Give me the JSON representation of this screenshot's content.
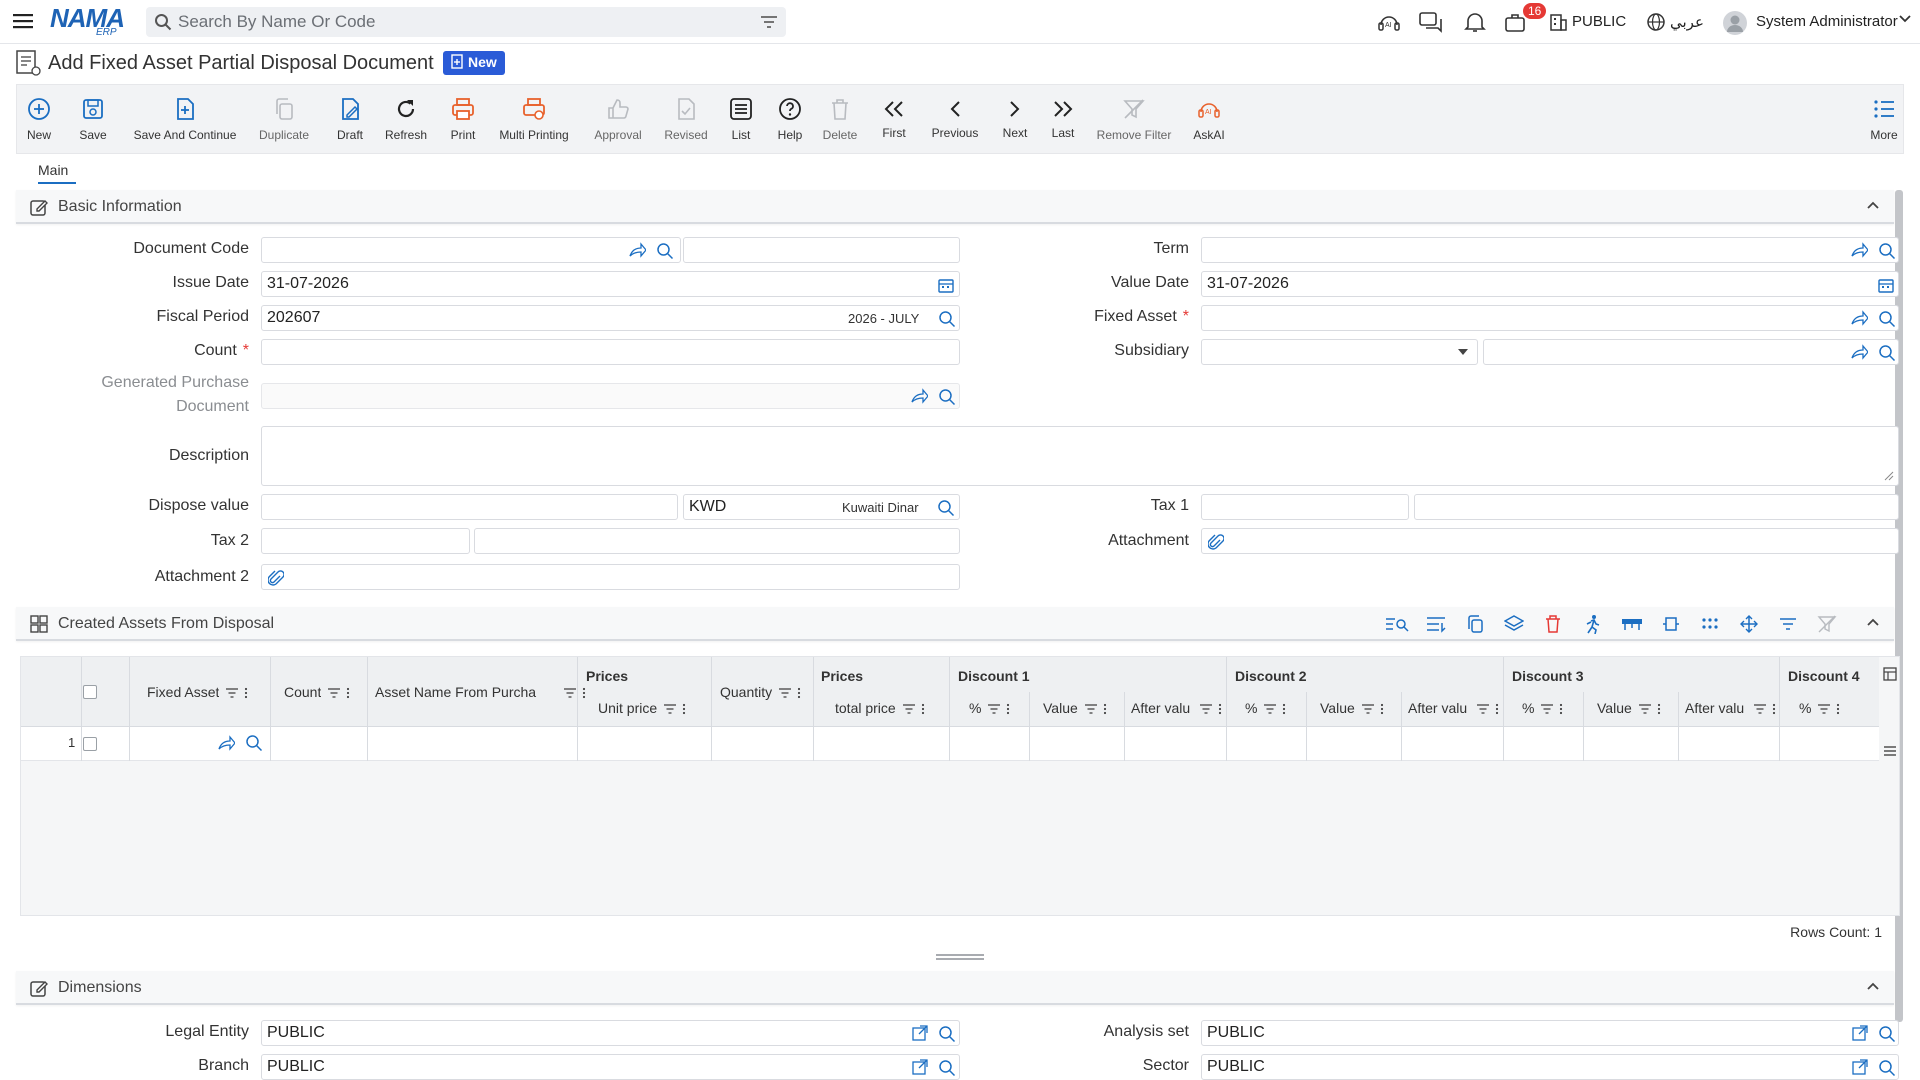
{
  "header": {
    "logo_main": "NAMA",
    "logo_sub": "ERP",
    "search_placeholder": "Search By Name Or Code",
    "notifications_count": "16",
    "company": "PUBLIC",
    "language": "عربي",
    "user": "System Administrator"
  },
  "page": {
    "title": "Add Fixed Asset Partial Disposal Document",
    "status_badge": "New"
  },
  "toolbar": [
    {
      "id": "new",
      "label": "New",
      "icon": "plus-circle-icon"
    },
    {
      "id": "save",
      "label": "Save",
      "icon": "save-icon"
    },
    {
      "id": "save-continue",
      "label": "Save And Continue",
      "icon": "save-continue-icon"
    },
    {
      "id": "duplicate",
      "label": "Duplicate",
      "icon": "duplicate-icon"
    },
    {
      "id": "draft",
      "label": "Draft",
      "icon": "draft-icon"
    },
    {
      "id": "refresh",
      "label": "Refresh",
      "icon": "refresh-icon"
    },
    {
      "id": "print",
      "label": "Print",
      "icon": "print-icon"
    },
    {
      "id": "multi-printing",
      "label": "Multi Printing",
      "icon": "multi-print-icon"
    },
    {
      "id": "approval",
      "label": "Approval",
      "icon": "thumbs-up-icon"
    },
    {
      "id": "revised",
      "label": "Revised",
      "icon": "revised-icon"
    },
    {
      "id": "list",
      "label": "List",
      "icon": "list-icon"
    },
    {
      "id": "help",
      "label": "Help",
      "icon": "help-icon"
    },
    {
      "id": "delete",
      "label": "Delete",
      "icon": "trash-icon"
    },
    {
      "id": "first",
      "label": "First",
      "icon": "double-chevron-left-icon"
    },
    {
      "id": "previous",
      "label": "Previous",
      "icon": "chevron-left-icon"
    },
    {
      "id": "next",
      "label": "Next",
      "icon": "chevron-right-icon"
    },
    {
      "id": "last",
      "label": "Last",
      "icon": "double-chevron-right-icon"
    },
    {
      "id": "remove-filter",
      "label": "Remove Filter",
      "icon": "filter-off-icon"
    },
    {
      "id": "askai",
      "label": "AskAI",
      "icon": "ai-icon"
    },
    {
      "id": "more",
      "label": "More",
      "icon": "more-list-icon"
    }
  ],
  "tabs": {
    "main": "Main"
  },
  "basic": {
    "title": "Basic Information",
    "document_code_label": "Document Code",
    "document_code": "",
    "issue_date_label": "Issue Date",
    "issue_date": "31-07-2026",
    "fiscal_period_label": "Fiscal Period",
    "fiscal_period": "202607",
    "fiscal_period_name": "2026 - JULY",
    "count_label": "Count",
    "count": "",
    "generated_purchase_label_1": "Generated Purchase",
    "generated_purchase_label_2": "Document",
    "description_label": "Description",
    "dispose_value_label": "Dispose value",
    "currency_code": "KWD",
    "currency_name": "Kuwaiti Dinar",
    "tax2_label": "Tax 2",
    "attachment2_label": "Attachment 2",
    "term_label": "Term",
    "value_date_label": "Value Date",
    "value_date": "31-07-2026",
    "fixed_asset_label": "Fixed Asset",
    "subsidiary_label": "Subsidiary",
    "tax1_label": "Tax 1",
    "attachment_label": "Attachment",
    "required_mark": "*"
  },
  "grid": {
    "title": "Created Assets From Disposal",
    "columns": {
      "fixed_asset": "Fixed Asset",
      "count": "Count",
      "asset_name": "Asset Name From Purcha",
      "prices_group_1": "Prices",
      "unit_price": "Unit price",
      "quantity": "Quantity",
      "prices_group_2": "Prices",
      "total_price": "total price",
      "discount1": "Discount 1",
      "discount2": "Discount 2",
      "discount3": "Discount 3",
      "discount4": "Discount 4",
      "pct": "%",
      "value": "Value",
      "after_value": "After valu"
    },
    "rows": [
      {
        "index": "1"
      }
    ],
    "rows_count": "Rows Count: 1"
  },
  "dimensions": {
    "title": "Dimensions",
    "legal_entity_label": "Legal Entity",
    "legal_entity": "PUBLIC",
    "branch_label": "Branch",
    "branch": "PUBLIC",
    "analysis_set_label": "Analysis set",
    "analysis_set": "PUBLIC",
    "sector_label": "Sector",
    "sector": "PUBLIC"
  },
  "colors": {
    "accent": "#1e63b5",
    "link": "#1b6ec2",
    "badge": "#2a5bd7",
    "danger": "#e53935",
    "print": "#e8612c"
  }
}
